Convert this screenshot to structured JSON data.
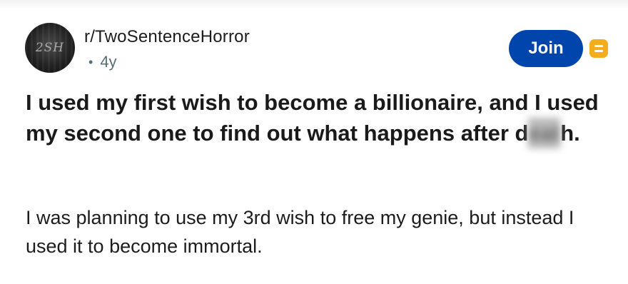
{
  "post": {
    "community": "r/TwoSentenceHorror",
    "separator": "•",
    "age": "4y",
    "avatar_text": "2SH",
    "join_label": "Join",
    "title_part1": "I used my first wish to become a billionaire, and I used my second one to find out what happens after d",
    "title_censored": "eat",
    "title_part2": "h.",
    "body": "I was planning to use my 3rd wish to free my genie, but instead I used it to become immortal."
  },
  "icons": {
    "save": "save-icon"
  },
  "colors": {
    "join": "#0045ac",
    "save": "#f4ae1d",
    "meta": "#576f76"
  }
}
